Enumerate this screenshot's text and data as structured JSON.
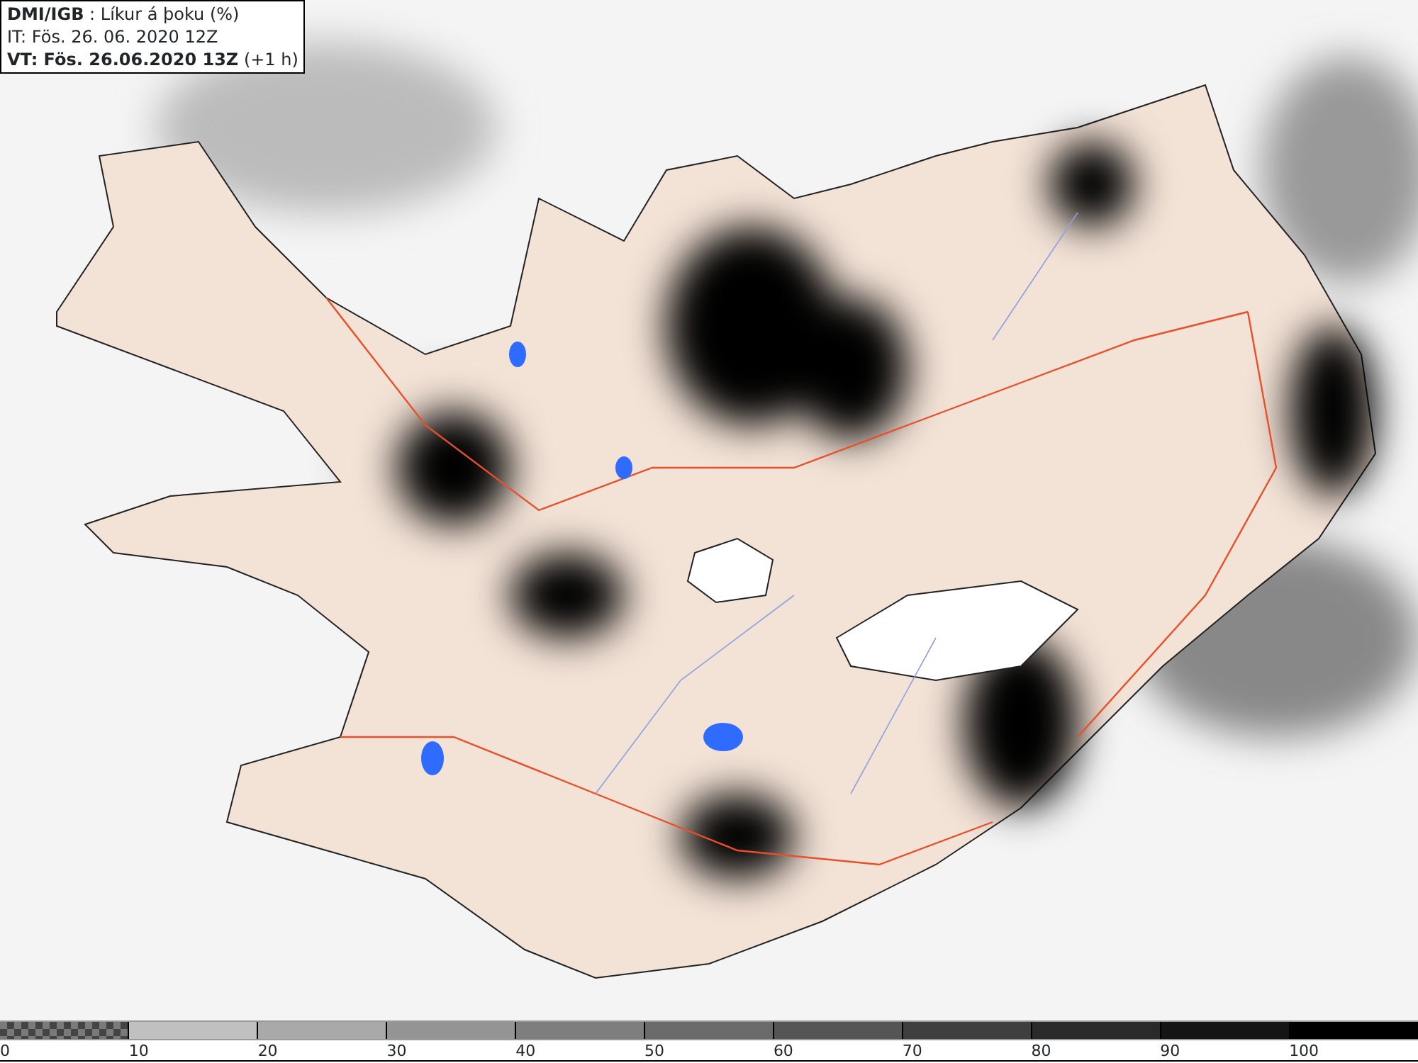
{
  "title_box": {
    "lines": [
      "**DMI/IGB** : Líkur á þoku (%)",
      "IT: Fös. 26. 06. 2020 12Z",
      "**VT: Fös. 26.06.2020 13Z** (+1 h)"
    ]
  },
  "legend": {
    "segments": [
      {
        "label": "0",
        "color": "#7a7a7a",
        "kind": "checker"
      },
      {
        "label": "10",
        "color": "#c0c0c0",
        "kind": "solid"
      },
      {
        "label": "20",
        "color": "#a9a9a9",
        "kind": "solid"
      },
      {
        "label": "30",
        "color": "#949494",
        "kind": "solid"
      },
      {
        "label": "40",
        "color": "#7e7e7e",
        "kind": "solid"
      },
      {
        "label": "50",
        "color": "#6a6a6a",
        "kind": "solid"
      },
      {
        "label": "60",
        "color": "#555555",
        "kind": "solid"
      },
      {
        "label": "70",
        "color": "#3f3f3f",
        "kind": "solid"
      },
      {
        "label": "80",
        "color": "#2a2a2a",
        "kind": "solid"
      },
      {
        "label": "90",
        "color": "#151515",
        "kind": "solid"
      },
      {
        "label": "100",
        "color": "#000000",
        "kind": "solid"
      }
    ]
  }
}
